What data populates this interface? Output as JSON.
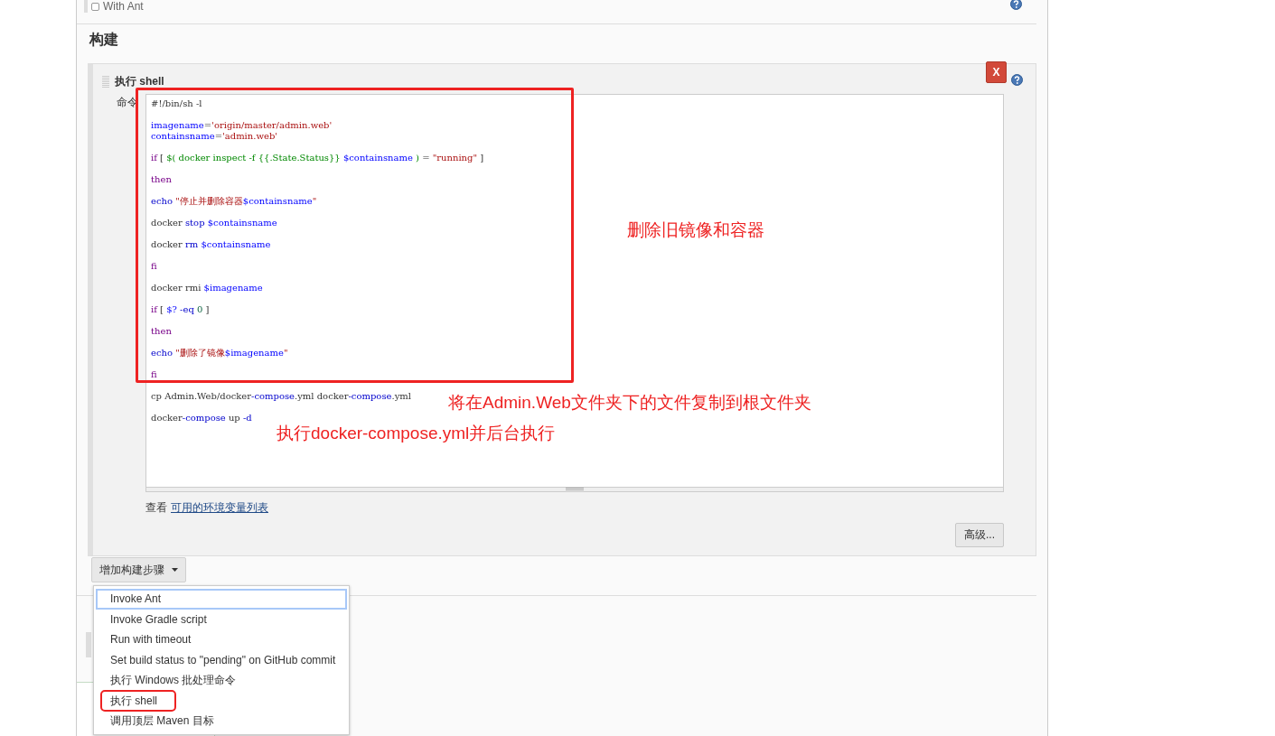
{
  "top_option": {
    "label": "With Ant",
    "checked": false
  },
  "section_title": "构建",
  "build_step": {
    "title": "执行 shell",
    "command_label": "命令",
    "code_lines": [
      {
        "kind": "code",
        "tokens": [
          {
            "text": "#!/bin/sh -l",
            "kind": "plain"
          }
        ]
      },
      {
        "kind": "blank"
      },
      {
        "kind": "code",
        "tokens": [
          {
            "text": "imagename",
            "kind": "variable"
          },
          {
            "text": "=",
            "kind": "plain"
          },
          {
            "text": "'origin/master/admin.web'",
            "kind": "string"
          }
        ]
      },
      {
        "kind": "code",
        "tokens": [
          {
            "text": "containsname",
            "kind": "variable"
          },
          {
            "text": "=",
            "kind": "plain"
          },
          {
            "text": "'admin.web'",
            "kind": "string"
          }
        ]
      },
      {
        "kind": "blank"
      },
      {
        "kind": "code",
        "tokens": [
          {
            "text": "if",
            "kind": "keyword"
          },
          {
            "text": " [ ",
            "kind": "plain"
          },
          {
            "text": "$( docker inspect -f {{.State.Status}} ",
            "kind": "command"
          },
          {
            "text": "$containsname",
            "kind": "variable"
          },
          {
            "text": " ) ",
            "kind": "command"
          },
          {
            "text": "= ",
            "kind": "plain"
          },
          {
            "text": "\"running\"",
            "kind": "string"
          },
          {
            "text": " ]",
            "kind": "plain"
          }
        ]
      },
      {
        "kind": "blank"
      },
      {
        "kind": "code",
        "tokens": [
          {
            "text": "then",
            "kind": "keyword"
          }
        ]
      },
      {
        "kind": "blank"
      },
      {
        "kind": "code",
        "tokens": [
          {
            "text": "echo",
            "kind": "builtin"
          },
          {
            "text": " \"停止并删除容器",
            "kind": "string"
          },
          {
            "text": "$containsname",
            "kind": "variable"
          },
          {
            "text": "\"",
            "kind": "string"
          }
        ]
      },
      {
        "kind": "blank"
      },
      {
        "kind": "code",
        "tokens": [
          {
            "text": "docker ",
            "kind": "plain"
          },
          {
            "text": "stop",
            "kind": "builtin"
          },
          {
            "text": " $containsname",
            "kind": "variable"
          }
        ]
      },
      {
        "kind": "blank"
      },
      {
        "kind": "code",
        "tokens": [
          {
            "text": "docker ",
            "kind": "plain"
          },
          {
            "text": "rm",
            "kind": "builtin"
          },
          {
            "text": " $containsname",
            "kind": "variable"
          }
        ]
      },
      {
        "kind": "blank"
      },
      {
        "kind": "code",
        "tokens": [
          {
            "text": "fi",
            "kind": "keyword"
          }
        ]
      },
      {
        "kind": "blank"
      },
      {
        "kind": "code",
        "tokens": [
          {
            "text": "docker rmi ",
            "kind": "plain"
          },
          {
            "text": "$imagename",
            "kind": "variable"
          }
        ]
      },
      {
        "kind": "blank"
      },
      {
        "kind": "code",
        "tokens": [
          {
            "text": "if",
            "kind": "keyword"
          },
          {
            "text": " [ ",
            "kind": "plain"
          },
          {
            "text": "$?",
            "kind": "variable"
          },
          {
            "text": " -eq",
            "kind": "builtin"
          },
          {
            "text": " 0",
            "kind": "number"
          },
          {
            "text": " ]",
            "kind": "plain"
          }
        ]
      },
      {
        "kind": "blank"
      },
      {
        "kind": "code",
        "tokens": [
          {
            "text": "then",
            "kind": "keyword"
          }
        ]
      },
      {
        "kind": "blank"
      },
      {
        "kind": "code",
        "tokens": [
          {
            "text": "echo",
            "kind": "builtin"
          },
          {
            "text": " \"删除了镜像",
            "kind": "string"
          },
          {
            "text": "$imagename",
            "kind": "variable"
          },
          {
            "text": "\"",
            "kind": "string"
          }
        ]
      },
      {
        "kind": "blank"
      },
      {
        "kind": "code",
        "tokens": [
          {
            "text": "fi",
            "kind": "keyword"
          }
        ]
      },
      {
        "kind": "blank"
      },
      {
        "kind": "code",
        "tokens": [
          {
            "text": "cp Admin.Web/docker",
            "kind": "plain"
          },
          {
            "text": "-compose",
            "kind": "builtin"
          },
          {
            "text": ".yml docker",
            "kind": "plain"
          },
          {
            "text": "-compose",
            "kind": "builtin"
          },
          {
            "text": ".yml",
            "kind": "plain"
          }
        ]
      },
      {
        "kind": "blank"
      },
      {
        "kind": "code",
        "tokens": [
          {
            "text": "docker",
            "kind": "plain"
          },
          {
            "text": "-compose",
            "kind": "builtin"
          },
          {
            "text": " up ",
            "kind": "plain"
          },
          {
            "text": "-d",
            "kind": "builtin"
          }
        ]
      }
    ],
    "help_prefix": "查看",
    "help_link": "可用的环境变量列表",
    "advanced_button": "高级...",
    "delete_button": "X"
  },
  "add_step_button": "增加构建步骤",
  "menu_items": [
    {
      "label": "Invoke Ant",
      "selected": true,
      "annotated": false
    },
    {
      "label": "Invoke Gradle script",
      "selected": false,
      "annotated": false
    },
    {
      "label": "Run with timeout",
      "selected": false,
      "annotated": false
    },
    {
      "label": "Set build status to \"pending\" on GitHub commit",
      "selected": false,
      "annotated": false
    },
    {
      "label": "执行 Windows 批处理命令",
      "selected": false,
      "annotated": false
    },
    {
      "label": "执行 shell",
      "selected": false,
      "annotated": true
    },
    {
      "label": "调用顶层 Maven 目标",
      "selected": false,
      "annotated": false
    }
  ],
  "annotations": [
    "删除旧镜像和容器",
    "将在Admin.Web文件夹下的文件复制到根文件夹",
    "执行docker-compose.yml并后台执行"
  ]
}
